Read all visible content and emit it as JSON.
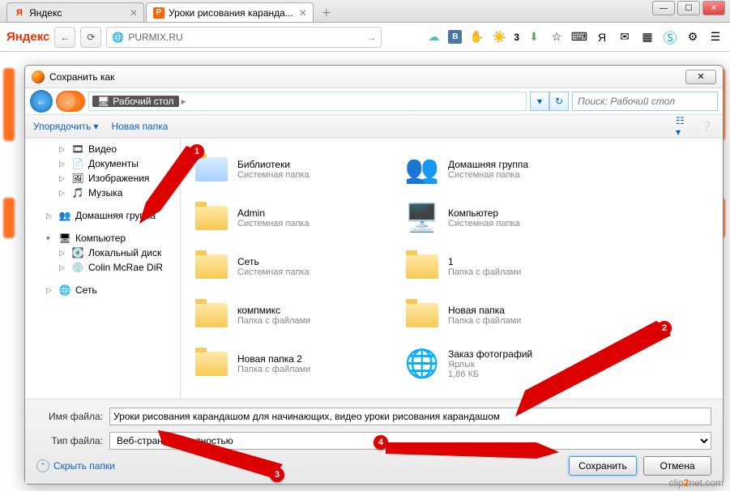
{
  "browser": {
    "tabs": [
      {
        "title": "Яндекс",
        "favicon": "Я",
        "favcolor": "#e30"
      },
      {
        "title": "Уроки рисования каранда...",
        "favicon": "Р",
        "favcolor": "#f60"
      }
    ],
    "logo": "Яндекс",
    "url": "PURMIX.RU",
    "weather": "3"
  },
  "dialog": {
    "title": "Сохранить как",
    "breadcrumb_loc": "Рабочий стол",
    "search_placeholder": "Поиск: Рабочий стол",
    "toolbar": {
      "organize": "Упорядочить",
      "newfolder": "Новая папка"
    },
    "tree": [
      {
        "label": "Видео",
        "icon": "🎞",
        "indent": 2,
        "expand": "▷"
      },
      {
        "label": "Документы",
        "icon": "📄",
        "indent": 2,
        "expand": "▷"
      },
      {
        "label": "Изображения",
        "icon": "🖼",
        "indent": 2,
        "expand": "▷"
      },
      {
        "label": "Музыка",
        "icon": "🎵",
        "indent": 2,
        "expand": "▷"
      },
      {
        "label": "",
        "icon": "",
        "indent": 0,
        "expand": ""
      },
      {
        "label": "Домашняя группа",
        "icon": "👥",
        "indent": 1,
        "expand": "▷"
      },
      {
        "label": "",
        "icon": "",
        "indent": 0,
        "expand": ""
      },
      {
        "label": "Компьютер",
        "icon": "🖥",
        "indent": 1,
        "expand": "▾"
      },
      {
        "label": "Локальный диск",
        "icon": "💽",
        "indent": 2,
        "expand": "▷"
      },
      {
        "label": "Colin McRae DiR",
        "icon": "💿",
        "indent": 2,
        "expand": "▷"
      },
      {
        "label": "",
        "icon": "",
        "indent": 0,
        "expand": ""
      },
      {
        "label": "Сеть",
        "icon": "🌐",
        "indent": 1,
        "expand": "▷"
      }
    ],
    "items_left": [
      {
        "name": "Библиотеки",
        "sub": "Системная папка",
        "kind": "lib"
      },
      {
        "name": "Admin",
        "sub": "Системная папка",
        "kind": "folder"
      },
      {
        "name": "Сеть",
        "sub": "Системная папка",
        "kind": "folder"
      },
      {
        "name": "компмикс",
        "sub": "Папка с файлами",
        "kind": "folder"
      },
      {
        "name": "Новая папка 2",
        "sub": "Папка с файлами",
        "kind": "folder"
      }
    ],
    "items_right": [
      {
        "name": "Домашняя группа",
        "sub": "Системная папка",
        "kind": "group"
      },
      {
        "name": "Компьютер",
        "sub": "Системная папка",
        "kind": "computer"
      },
      {
        "name": "1",
        "sub": "Папка с файлами",
        "kind": "folder"
      },
      {
        "name": "Новая папка",
        "sub": "Папка с файлами",
        "kind": "folder"
      },
      {
        "name": "Заказ фотографий",
        "sub": "Ярлык",
        "sub2": "1,86 КБ",
        "kind": "link"
      }
    ],
    "filename_label": "Имя файла:",
    "filename_value": "Уроки рисования карандашом для начинающих, видео уроки рисования карандашом",
    "filetype_label": "Тип файла:",
    "filetype_value": "Веб-страница, полностью",
    "hide_folders": "Скрыть папки",
    "save": "Сохранить",
    "cancel": "Отмена"
  },
  "annotations": {
    "1": "1",
    "2": "2",
    "3": "3",
    "4": "4"
  },
  "watermark": "clip2net.com"
}
